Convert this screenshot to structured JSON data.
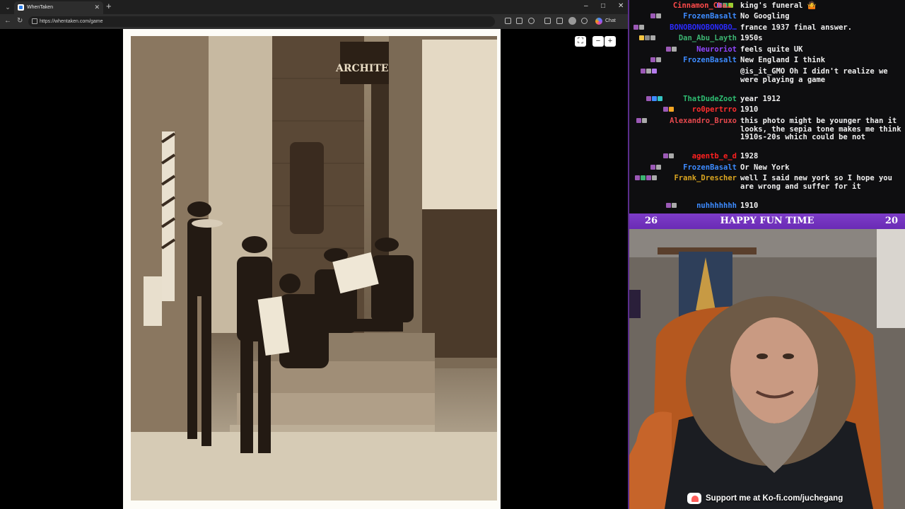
{
  "browser": {
    "tab": {
      "title": "WhenTaken",
      "favicon": "whentaken-icon"
    },
    "url": "https://whentaken.com/game",
    "chat_label": "Chat",
    "window_controls": {
      "minimize": "–",
      "maximize": "□",
      "close": "✕"
    }
  },
  "game": {
    "photo_description_icon": "sepia-photo-newsboys-street",
    "zoom": {
      "fit": "⛶",
      "minus": "−",
      "plus": "+"
    }
  },
  "chat": {
    "messages": [
      {
        "user": "Cinnamon_Cha…",
        "color": "#ff4a4a",
        "text": "king's funeral 🤷",
        "badges": [
          "#7b68ee",
          "#3cb371",
          "#9acd32"
        ]
      },
      {
        "user": "FrozenBasalt",
        "color": "#3d8bff",
        "text": "No Googling",
        "badges": [
          "#9b59b6",
          "#aaaaaa"
        ]
      },
      {
        "user": "BONOBONOBONOBO…",
        "color": "#2b2bff",
        "text": "france 1937 final answer.",
        "badges": [
          "#9b59b6",
          "#aaaaaa"
        ]
      },
      {
        "user": "Dan_Abu_Layth",
        "color": "#3cb371",
        "text": "1950s",
        "badges": [
          "#f5c542",
          "#888888",
          "#aaaaaa"
        ]
      },
      {
        "user": "Neuroriot",
        "color": "#9146ff",
        "text": "feels quite UK",
        "badges": [
          "#9b59b6",
          "#aaaaaa"
        ]
      },
      {
        "user": "FrozenBasalt",
        "color": "#3d8bff",
        "text": "New England I think",
        "badges": [
          "#9b59b6",
          "#aaaaaa"
        ]
      },
      {
        "user": "",
        "color": "#ffffff",
        "text": "@is_it_GMO Oh I didn't realize we were playing a game",
        "badges": [
          "#9b59b6",
          "#aaaaaa",
          "#b57bee"
        ]
      },
      {
        "user": "ThatDudeZoot",
        "color": "#2ebd72",
        "text": "year 1912",
        "badges": [
          "#9b59b6",
          "#3d8bff",
          "#35c4c4"
        ]
      },
      {
        "user": "ro0pertrro",
        "color": "#ff2e2e",
        "text": "1910",
        "badges": [
          "#9b59b6",
          "#f5a623"
        ]
      },
      {
        "user": "Alexandro_Bruxo",
        "color": "#e5484d",
        "text": "this photo might be younger than it looks, the sepia tone makes me think 1910s-20s which could be not",
        "badges": [
          "#9b59b6",
          "#aaaaaa"
        ]
      },
      {
        "user": "agentb_e_d",
        "color": "#ff2020",
        "text": "1928",
        "badges": [
          "#9b59b6",
          "#aaaaaa"
        ]
      },
      {
        "user": "FrozenBasalt",
        "color": "#3d8bff",
        "text": "Or New York",
        "badges": [
          "#9b59b6",
          "#aaaaaa"
        ]
      },
      {
        "user": "Frank_Drescher",
        "color": "#daa520",
        "text": "well I said new york so I hope you are wrong and suffer for it",
        "badges": [
          "#9b59b6",
          "#3cb371",
          "#9b59b6",
          "#aaaaaa"
        ]
      },
      {
        "user": "nuhhhhhhh",
        "color": "#3d8bff",
        "text": "1910",
        "badges": [
          "#9b59b6",
          "#aaaaaa"
        ]
      }
    ]
  },
  "cam": {
    "header": {
      "left_number": "26",
      "title": "HAPPY FUN TIME",
      "right_number": "20",
      "color": "#7d3cc8"
    },
    "kofi_text": "Support me at Ko-fi.com/juchegang"
  }
}
